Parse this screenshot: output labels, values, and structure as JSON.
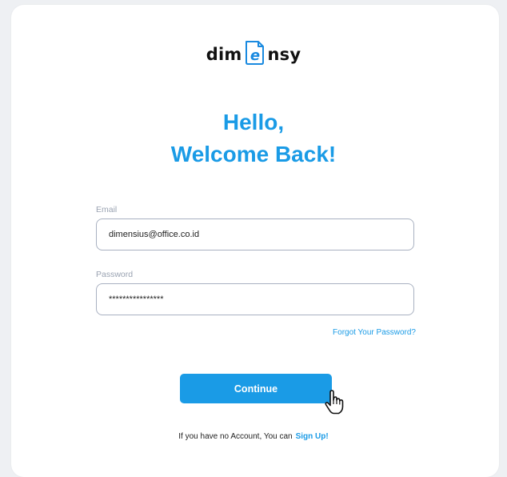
{
  "brand": {
    "name_left": "dim",
    "logo_mark_letter": "e",
    "name_right": "nsy"
  },
  "header": {
    "line1": "Hello,",
    "line2": "Welcome Back!"
  },
  "form": {
    "email_label": "Email",
    "email_value": "dimensius@office.co.id",
    "password_label": "Password",
    "password_value": "****************",
    "forgot_link": "Forgot Your Password?",
    "continue_label": "Continue"
  },
  "footer": {
    "prompt": "If you have no Account, You can",
    "signup_link": "Sign Up!"
  },
  "colors": {
    "accent": "#1a9be6",
    "field_border": "#a9b1c1",
    "label": "#9aa3b2"
  },
  "icons": {
    "cursor": "hand-pointer-icon"
  }
}
